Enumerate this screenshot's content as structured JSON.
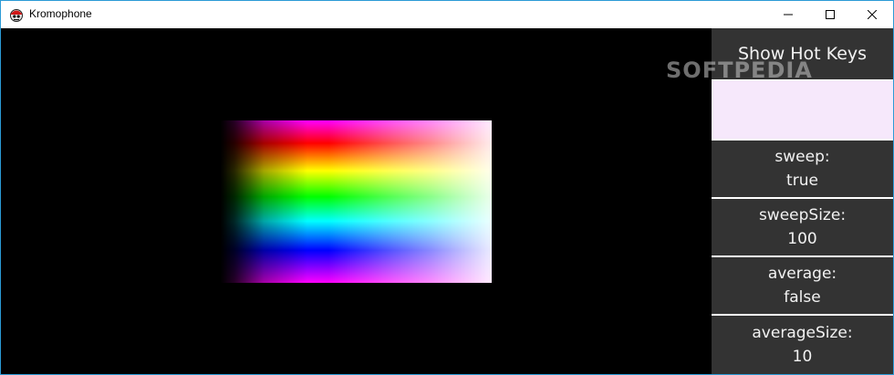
{
  "window": {
    "title": "Kromophone",
    "border_color": "#2b9bd6"
  },
  "icons": {
    "app": "kromophone-app-icon",
    "minimize": "minimize-icon",
    "maximize": "maximize-icon",
    "close": "close-icon"
  },
  "panel": {
    "hotkeys_label": "Show Hot Keys",
    "current_color": "#f6e8fb",
    "settings": [
      {
        "label": "sweep:",
        "value": "true"
      },
      {
        "label": "sweepSize:",
        "value": "100"
      },
      {
        "label": "average:",
        "value": "false"
      },
      {
        "label": "averageSize:",
        "value": "10"
      }
    ]
  },
  "watermark": "SOFTPEDIA"
}
